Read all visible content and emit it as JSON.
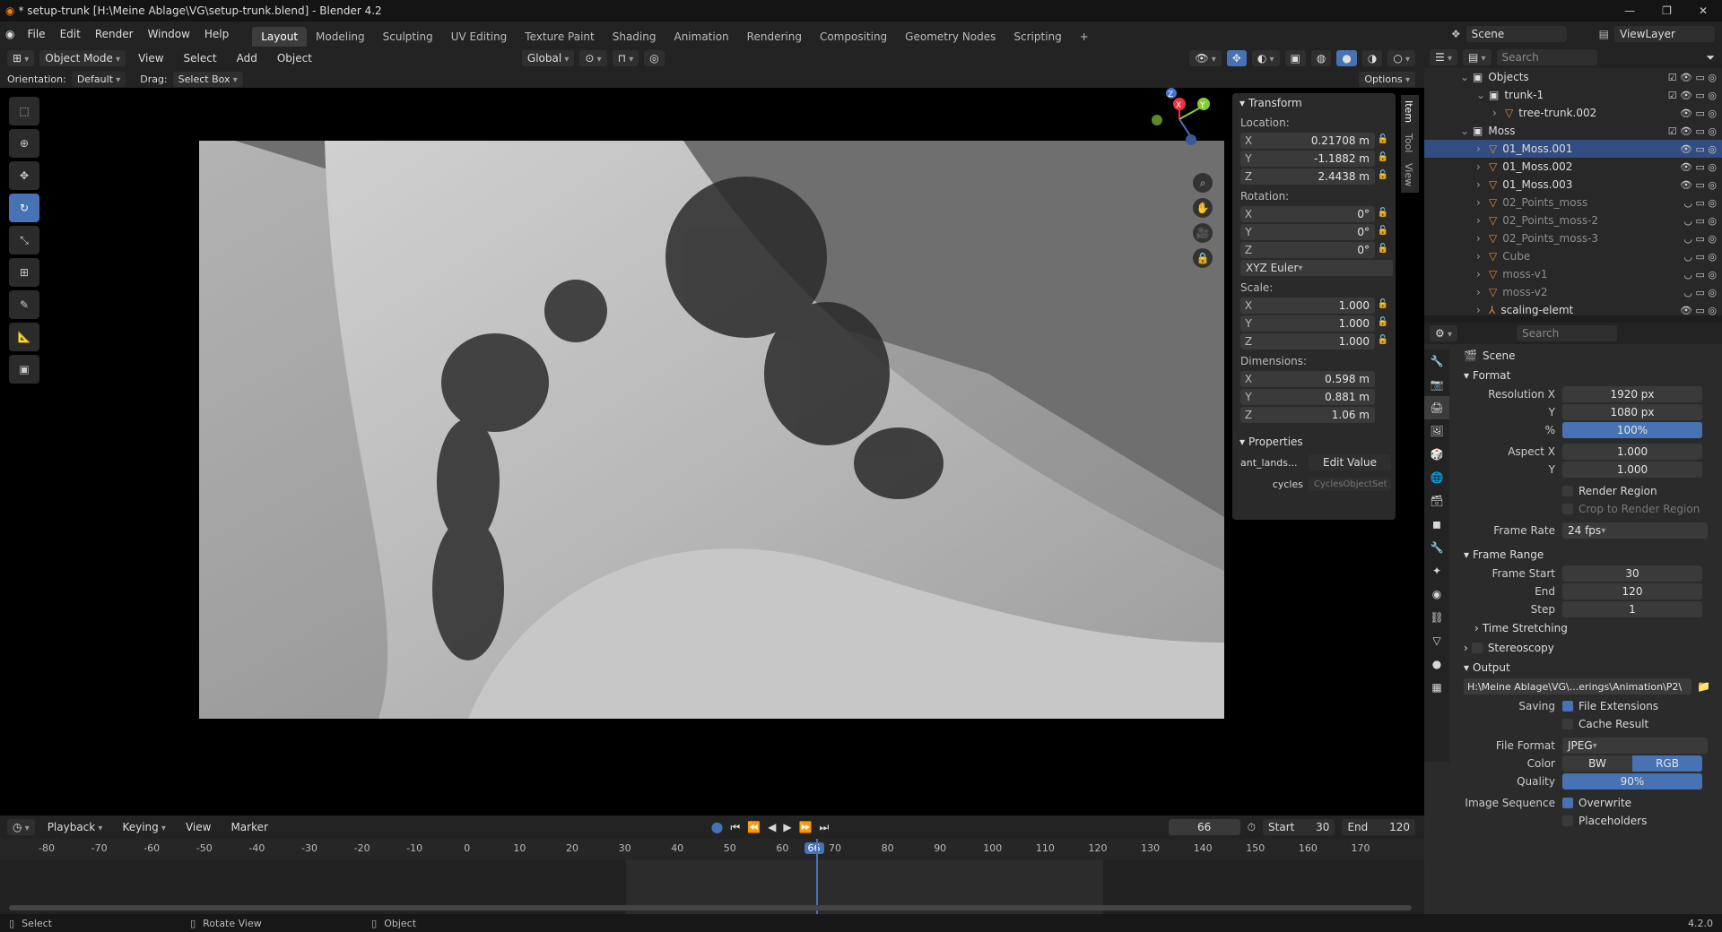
{
  "title": "* setup-trunk [H:\\Meine Ablage\\VG\\setup-trunk.blend] - Blender 4.2",
  "menus": [
    "File",
    "Edit",
    "Render",
    "Window",
    "Help"
  ],
  "workspaces": [
    "Layout",
    "Modeling",
    "Sculpting",
    "UV Editing",
    "Texture Paint",
    "Shading",
    "Animation",
    "Rendering",
    "Compositing",
    "Geometry Nodes",
    "Scripting"
  ],
  "active_workspace": "Layout",
  "scene_name": "Scene",
  "viewlayer_name": "ViewLayer",
  "viewport": {
    "mode": "Object Mode",
    "menus": [
      "View",
      "Select",
      "Add",
      "Object"
    ],
    "transform_orientation": "Global",
    "orientation_label": "Orientation:",
    "orientation_value": "Default",
    "drag_label": "Drag:",
    "drag_value": "Select Box",
    "options": "Options"
  },
  "npanel": {
    "tabs": [
      "Item",
      "Tool",
      "View"
    ],
    "transform_title": "Transform",
    "location_label": "Location:",
    "location": [
      {
        "ax": "X",
        "val": "0.21708 m"
      },
      {
        "ax": "Y",
        "val": "-1.1882 m"
      },
      {
        "ax": "Z",
        "val": "2.4438 m"
      }
    ],
    "rotation_label": "Rotation:",
    "rotation": [
      {
        "ax": "X",
        "val": "0°"
      },
      {
        "ax": "Y",
        "val": "0°"
      },
      {
        "ax": "Z",
        "val": "0°"
      }
    ],
    "rotation_mode": "XYZ Euler",
    "scale_label": "Scale:",
    "scale": [
      {
        "ax": "X",
        "val": "1.000"
      },
      {
        "ax": "Y",
        "val": "1.000"
      },
      {
        "ax": "Z",
        "val": "1.000"
      }
    ],
    "dimensions_label": "Dimensions:",
    "dimensions": [
      {
        "ax": "X",
        "val": "0.598 m"
      },
      {
        "ax": "Y",
        "val": "0.881 m"
      },
      {
        "ax": "Z",
        "val": "1.06 m"
      }
    ],
    "properties_title": "Properties",
    "prop1_label": "ant_lands...",
    "prop1_button": "Edit Value",
    "prop2_label": "cycles",
    "prop2_value": "CyclesObjectSet"
  },
  "outliner": {
    "search_placeholder": "Search",
    "rows": [
      {
        "label": "Objects",
        "indent": 0,
        "icon": "collection"
      },
      {
        "label": "trunk-1",
        "indent": 1,
        "icon": "collection"
      },
      {
        "label": "tree-trunk.002",
        "indent": 2,
        "icon": "mesh"
      },
      {
        "label": "Moss",
        "indent": 0,
        "icon": "collection"
      },
      {
        "label": "01_Moss.001",
        "indent": 1,
        "icon": "mesh",
        "selected": true
      },
      {
        "label": "01_Moss.002",
        "indent": 1,
        "icon": "mesh"
      },
      {
        "label": "01_Moss.003",
        "indent": 1,
        "icon": "mesh"
      },
      {
        "label": "02_Points_moss",
        "indent": 1,
        "icon": "mesh",
        "dim": true
      },
      {
        "label": "02_Points_moss-2",
        "indent": 1,
        "icon": "mesh",
        "dim": true
      },
      {
        "label": "02_Points_moss-3",
        "indent": 1,
        "icon": "mesh",
        "dim": true
      },
      {
        "label": "Cube",
        "indent": 1,
        "icon": "mesh",
        "dim": true
      },
      {
        "label": "moss-v1",
        "indent": 1,
        "icon": "mesh",
        "dim": true
      },
      {
        "label": "moss-v2",
        "indent": 1,
        "icon": "mesh",
        "dim": true
      },
      {
        "label": "scaling-elemt",
        "indent": 1,
        "icon": "armature"
      }
    ]
  },
  "properties": {
    "search_placeholder": "Search",
    "scene": "Scene",
    "format_title": "Format",
    "res_x_label": "Resolution X",
    "res_x": "1920 px",
    "res_y_label": "Y",
    "res_y": "1080 px",
    "res_pct_label": "%",
    "res_pct": "100%",
    "aspect_x_label": "Aspect X",
    "aspect_x": "1.000",
    "aspect_y_label": "Y",
    "aspect_y": "1.000",
    "render_region": "Render Region",
    "crop_region": "Crop to Render Region",
    "frame_rate_label": "Frame Rate",
    "frame_rate": "24 fps",
    "frame_range_title": "Frame Range",
    "frame_start_label": "Frame Start",
    "frame_start": "30",
    "frame_end_label": "End",
    "frame_end": "120",
    "frame_step_label": "Step",
    "frame_step": "1",
    "time_stretching": "Time Stretching",
    "stereoscopy": "Stereoscopy",
    "output_title": "Output",
    "output_path": "H:\\Meine Ablage\\VG\\...erings\\Animation\\P2\\",
    "saving_label": "Saving",
    "file_extensions": "File Extensions",
    "cache_result": "Cache Result",
    "file_format_label": "File Format",
    "file_format": "JPEG",
    "color_label": "Color",
    "color_bw": "BW",
    "color_rgb": "RGB",
    "quality_label": "Quality",
    "quality": "90%",
    "image_sequence_label": "Image Sequence",
    "overwrite": "Overwrite",
    "placeholders": "Placeholders"
  },
  "timeline": {
    "menus": [
      "Playback",
      "Keying",
      "View",
      "Marker"
    ],
    "current_frame": "66",
    "start_label": "Start",
    "start": "30",
    "end_label": "End",
    "end": "120",
    "ticks": [
      "-80",
      "-70",
      "-60",
      "-50",
      "-40",
      "-30",
      "-20",
      "-10",
      "0",
      "10",
      "20",
      "30",
      "40",
      "50",
      "60",
      "66",
      "70",
      "80",
      "90",
      "100",
      "110",
      "120",
      "130",
      "140",
      "150",
      "160",
      "170"
    ]
  },
  "status": {
    "select": "Select",
    "rotate": "Rotate View",
    "object": "Object",
    "version": "4.2.0"
  },
  "colors": {
    "accent": "#4772b3",
    "selected_row": "#334d80",
    "mesh_icon": "#e08c3a"
  }
}
